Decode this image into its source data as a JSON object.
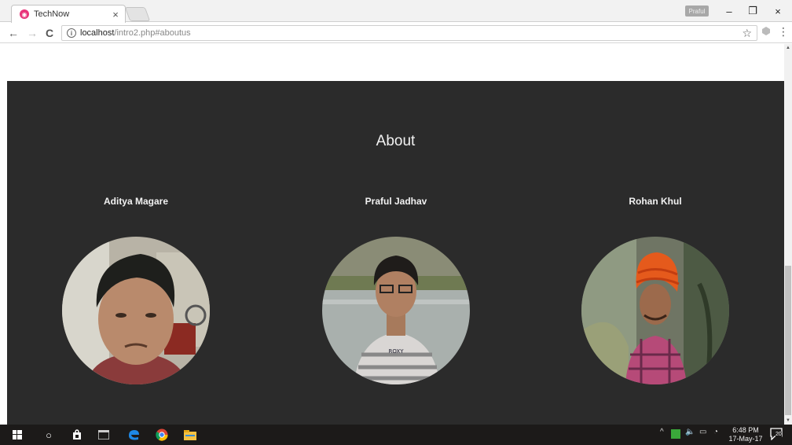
{
  "browser": {
    "tab_title": "TechNow",
    "tab_close": "×",
    "profile_name": "Praful",
    "minimize": "–",
    "restore": "❐",
    "close": "×",
    "url_host": "localhost",
    "url_path": "/intro2.php#aboutus",
    "back": "←",
    "forward": "→",
    "reload": "C",
    "star": "☆",
    "menu": "⋮"
  },
  "about": {
    "title": "About",
    "members": [
      {
        "name": "Aditya Magare"
      },
      {
        "name": "Praful Jadhav"
      },
      {
        "name": "Rohan Khul"
      }
    ]
  },
  "taskbar": {
    "time": "6:48 PM",
    "date": "17-May-17",
    "notification_count": "20"
  },
  "colors": {
    "section_bg": "#2b2b2b",
    "heading_text": "#f2f2f2",
    "taskbar_bg": "#1c1a19",
    "favicon": "#e8347a"
  }
}
